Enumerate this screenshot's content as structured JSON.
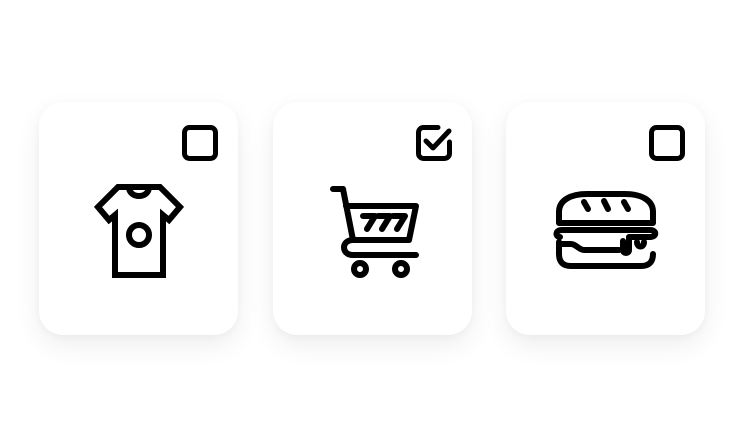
{
  "items": [
    {
      "icon": "t-shirt-icon",
      "checked": false
    },
    {
      "icon": "shopping-cart-icon",
      "checked": true
    },
    {
      "icon": "burger-icon",
      "checked": false
    }
  ],
  "colors": {
    "stroke": "#000000",
    "card": "#ffffff",
    "background": "#ffffff"
  }
}
